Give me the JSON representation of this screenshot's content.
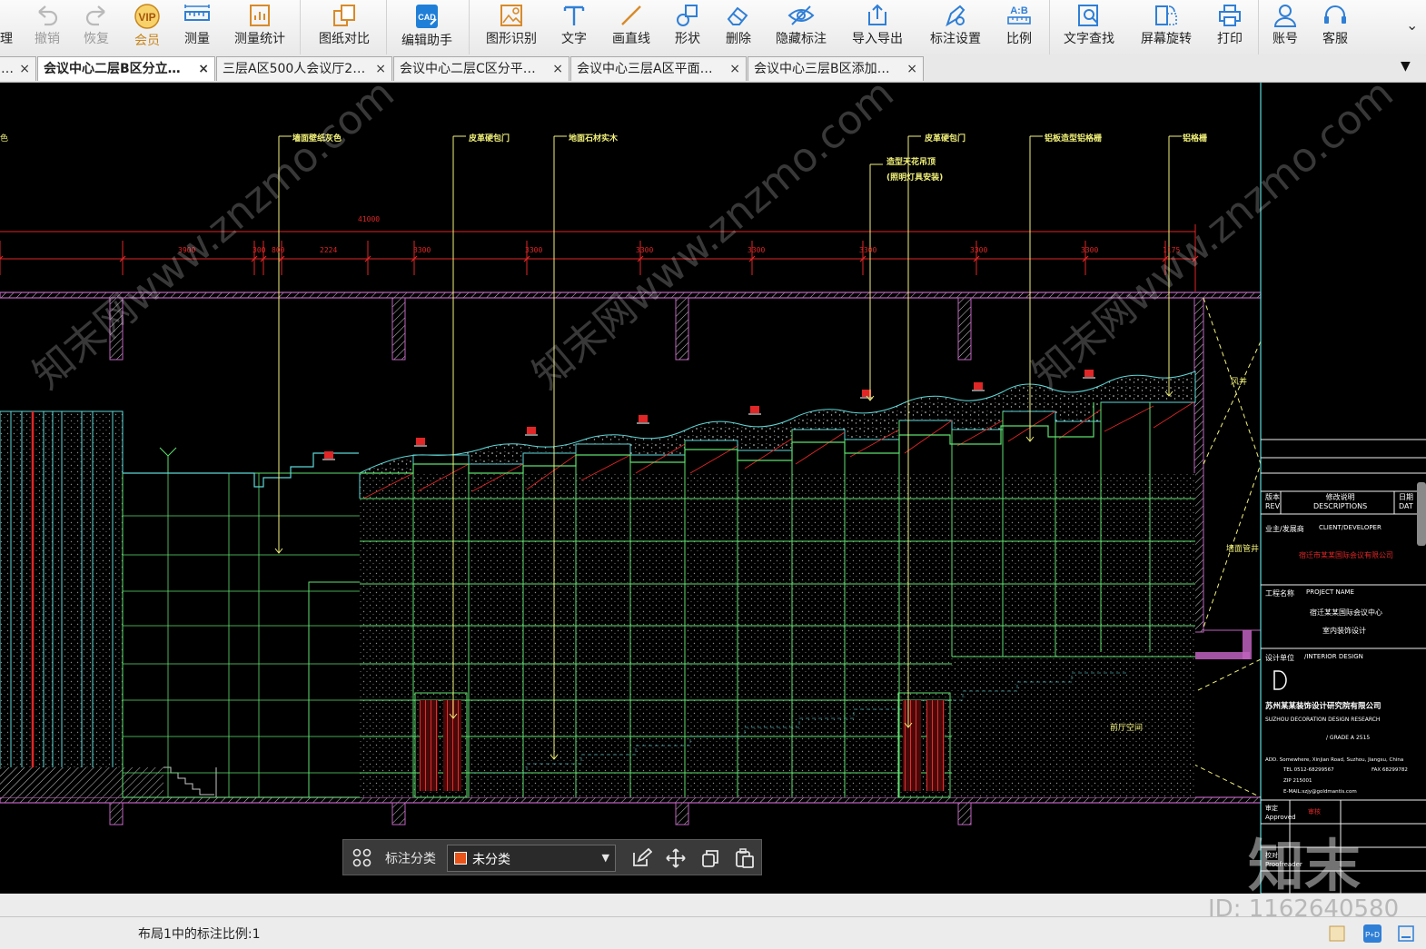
{
  "toolbar": {
    "items": [
      {
        "label": "撤销",
        "icon": "undo-icon",
        "disabled": true
      },
      {
        "label": "恢复",
        "icon": "redo-icon",
        "disabled": true
      },
      {
        "label": "会员",
        "icon": "vip-icon",
        "vip": true
      },
      {
        "label": "测量",
        "icon": "ruler-icon"
      },
      {
        "label": "测量统计",
        "icon": "measure-stats-icon"
      },
      {
        "label": "图纸对比",
        "icon": "compare-icon"
      },
      {
        "label": "编辑助手",
        "icon": "cad-edit-icon"
      },
      {
        "label": "图形识别",
        "icon": "shape-recognize-icon"
      },
      {
        "label": "文字",
        "icon": "text-icon"
      },
      {
        "label": "画直线",
        "icon": "line-icon"
      },
      {
        "label": "形状",
        "icon": "shape-icon"
      },
      {
        "label": "删除",
        "icon": "eraser-icon"
      },
      {
        "label": "隐藏标注",
        "icon": "hide-eye-icon"
      },
      {
        "label": "导入导出",
        "icon": "import-export-icon"
      },
      {
        "label": "标注设置",
        "icon": "annotation-settings-icon"
      },
      {
        "label": "比例",
        "icon": "scale-icon"
      },
      {
        "label": "文字查找",
        "icon": "text-search-icon"
      },
      {
        "label": "屏幕旋转",
        "icon": "rotate-screen-icon"
      },
      {
        "label": "打印",
        "icon": "printer-icon"
      },
      {
        "label": "账号",
        "icon": "user-icon"
      },
      {
        "label": "客服",
        "icon": "headset-icon"
      }
    ],
    "left_cut_label": "理"
  },
  "tabs": [
    {
      "label": "…"
    },
    {
      "label": "会议中心二层B区分立…",
      "active": true
    },
    {
      "label": "三层A区500人会议厅2…"
    },
    {
      "label": "会议中心二层C区分平…"
    },
    {
      "label": "会议中心三层A区平面…"
    },
    {
      "label": "会议中心三层B区添加…"
    }
  ],
  "tab_close_glyph": "×",
  "tab_dropdown_glyph": "▼",
  "drawing": {
    "overall_dimension": "41000",
    "segment_dimensions": [
      "3900",
      "300",
      "800",
      "2224",
      "3300",
      "3300",
      "3300",
      "3300",
      "3300",
      "3300",
      "3300",
      "1175"
    ],
    "callouts": [
      "墙面壁纸灰色",
      "皮革硬包门",
      "地面石材实木",
      "造型天花吊顶",
      "(照明灯具安装)",
      "皮革硬包门",
      "铝板造型铝格栅",
      "铝格栅"
    ],
    "left_cut_text": "色",
    "right_labels": [
      "风井",
      "墙面管井",
      "前厅空间"
    ],
    "title_block": {
      "rev": "版本",
      "rev_en": "REV",
      "desc": "修改说明",
      "desc_en": "DESCRIPTIONS",
      "date": "日期",
      "date_en": "DAT",
      "client": "业主/发展商",
      "client_en": "CLIENT/DEVELOPER",
      "client_name": "宿迁市某某国际会议有限公司",
      "project": "工程名称",
      "project_en": "PROJECT NAME",
      "project_name": "宿迁某某国际会议中心",
      "project_sub": "室内装饰设计",
      "design": "设计单位",
      "design_en": "/INTERIOR DESIGN",
      "company": "苏州某某装饰设计研究院有限公司",
      "company_en": "SUZHOU DECORATION DESIGN RESEARCH",
      "grade": "/ GRADE  A  2515",
      "address": "ADD. Somewhere, Xinjian Road, Suzhou, Jiangsu, China",
      "tel": "TEL 0512-68299567",
      "fax": "FAX 68299782",
      "zip": "ZIP 215001",
      "email": "E-MAIL:szjy@goldmantis.com",
      "approved": "审定",
      "approved_en": "Approved",
      "checked": "审核",
      "proofed": "校对",
      "proofed_en": "Proofreader"
    }
  },
  "watermark": {
    "text": "知末网www.znzmo.com",
    "logo": "知末",
    "id_text": "ID: 1162640580"
  },
  "annotation_bar": {
    "label": "标注分类",
    "category": "未分类",
    "category_color": "#e8541a"
  },
  "status": {
    "scale_text": "布局1中的标注比例:1"
  },
  "colors": {
    "magenta": "#c062c0",
    "green": "#5ee06e",
    "cyan": "#5ed8d8",
    "yellow": "#f2f27a",
    "red": "#e02626",
    "white": "#ffffff"
  }
}
